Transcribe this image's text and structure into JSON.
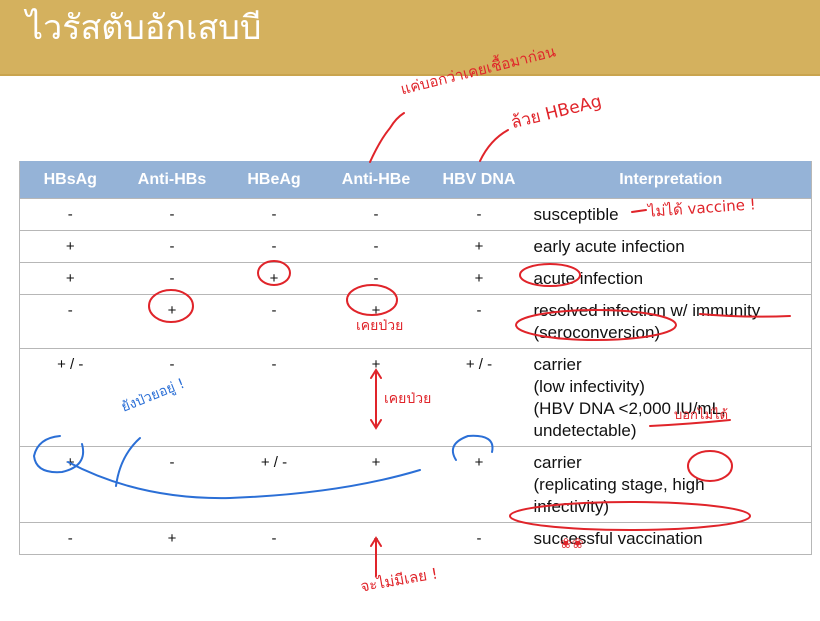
{
  "slide": {
    "title": "ไวรัสตับอักเสบบี"
  },
  "table": {
    "headers": [
      "HBsAg",
      "Anti-HBs",
      "HBeAg",
      "Anti-HBe",
      "HBV DNA",
      "Interpretation"
    ],
    "rows": [
      {
        "cells": [
          "-",
          "-",
          "-",
          "-",
          "-"
        ],
        "interpretation": [
          "susceptible"
        ]
      },
      {
        "cells": [
          "+",
          "-",
          "-",
          "-",
          "+"
        ],
        "interpretation": [
          "early acute infection"
        ]
      },
      {
        "cells": [
          "+",
          "-",
          "+",
          "-",
          "+"
        ],
        "interpretation": [
          "acute infection"
        ]
      },
      {
        "cells": [
          "-",
          "+",
          "-",
          "+",
          "-"
        ],
        "interpretation": [
          "resolved infection w/ immunity",
          "(seroconversion)"
        ]
      },
      {
        "cells": [
          "+ / -",
          "-",
          "-",
          "+",
          "+ / -"
        ],
        "interpretation": [
          "carrier",
          "(low infectivity)",
          "(HBV DNA <2,000 IU/mL,",
          "undetectable)"
        ]
      },
      {
        "cells": [
          "+",
          "-",
          "+ / -",
          "+",
          "+"
        ],
        "interpretation": [
          "carrier",
          "(replicating stage, high",
          "infectivity)"
        ]
      },
      {
        "cells": [
          "-",
          "+",
          "-",
          "-",
          "-"
        ],
        "interpretation": [
          "successful vaccination"
        ]
      }
    ]
  },
  "annotations": {
    "top_note_1": "แค่บอกว่าเคยเชื้อมาก่อน",
    "top_note_2": "ล้วย HBeAg",
    "susceptible_note": "ไม่ได้ vaccine !",
    "row4_note": "เคยป่วย",
    "arrow_note": "เคยป่วย",
    "undetectable_note": "บอกไม่ได้",
    "blue_note": "ยังป่วยอยู่ !",
    "bottom_note": "จะไม่มีเลย !",
    "vaccination_mark": "❀❀",
    "ink_red": "#e0242a",
    "ink_blue": "#2b6fd6"
  }
}
